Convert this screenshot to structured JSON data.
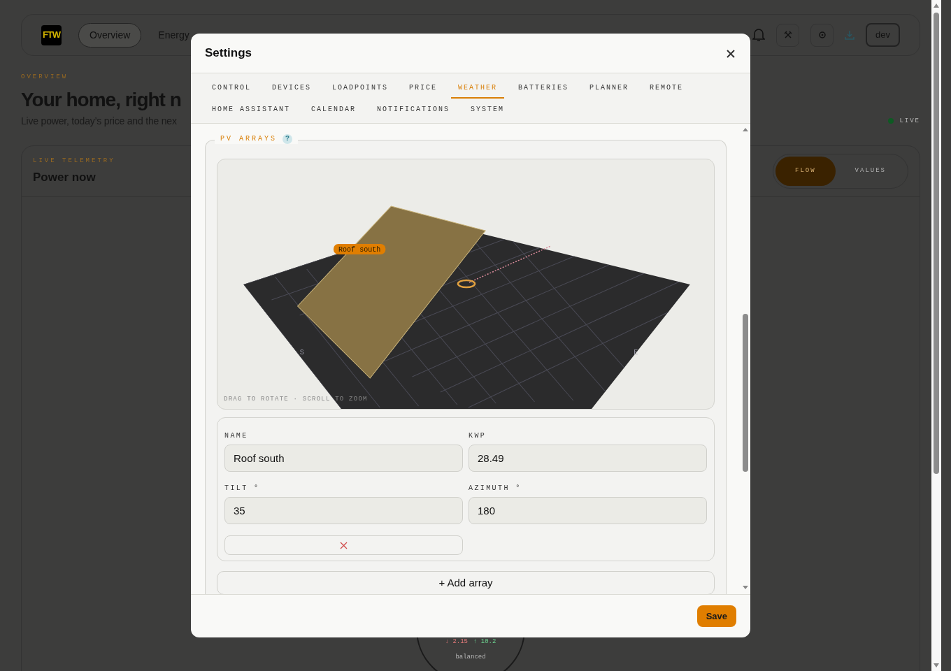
{
  "app": {
    "logo": "FTW",
    "nav": [
      {
        "label": "Overview",
        "selected": true
      },
      {
        "label": "Energy",
        "selected": false
      }
    ],
    "user": "dev"
  },
  "overview": {
    "eyebrow": "OVERVIEW",
    "title": "Your home, right n",
    "subtitle": "Live power, today’s price and the nex",
    "status": {
      "label": "LIVE",
      "color": "#0e5a23"
    }
  },
  "power_card": {
    "eyebrow": "LIVE TELEMETRY",
    "title": "Power now",
    "views": [
      {
        "label": "FLOW",
        "selected": true
      },
      {
        "label": "VALUES",
        "selected": false
      }
    ],
    "grid_node": {
      "import": "↓ 2.15",
      "export": "↑ 10.2",
      "state": "balanced"
    }
  },
  "settings": {
    "title": "Settings",
    "tabs": [
      {
        "label": "CONTROL",
        "selected": false
      },
      {
        "label": "DEVICES",
        "selected": false
      },
      {
        "label": "LOADPOINTS",
        "selected": false
      },
      {
        "label": "PRICE",
        "selected": false
      },
      {
        "label": "WEATHER",
        "selected": true
      },
      {
        "label": "BATTERIES",
        "selected": false
      },
      {
        "label": "PLANNER",
        "selected": false
      },
      {
        "label": "REMOTE",
        "selected": false
      },
      {
        "label": "HOME ASSISTANT",
        "selected": false
      },
      {
        "label": "CALENDAR",
        "selected": false
      },
      {
        "label": "NOTIFICATIONS",
        "selected": false
      },
      {
        "label": "SYSTEM",
        "selected": false
      }
    ],
    "section": {
      "legend": "PV ARRAYS",
      "help": "?",
      "scene": {
        "label": "Roof south",
        "axis_labels": [
          "S",
          "E"
        ],
        "hint": "DRAG TO ROTATE · SCROLL TO ZOOM"
      },
      "arrays": [
        {
          "fields": [
            {
              "label": "NAME",
              "value": "Roof south"
            },
            {
              "label": "KWP",
              "value": "28.49"
            },
            {
              "label": "TILT °",
              "value": "35"
            },
            {
              "label": "AZIMUTH °",
              "value": "180"
            }
          ]
        }
      ],
      "add_button": "+ Add array"
    },
    "save": "Save"
  }
}
